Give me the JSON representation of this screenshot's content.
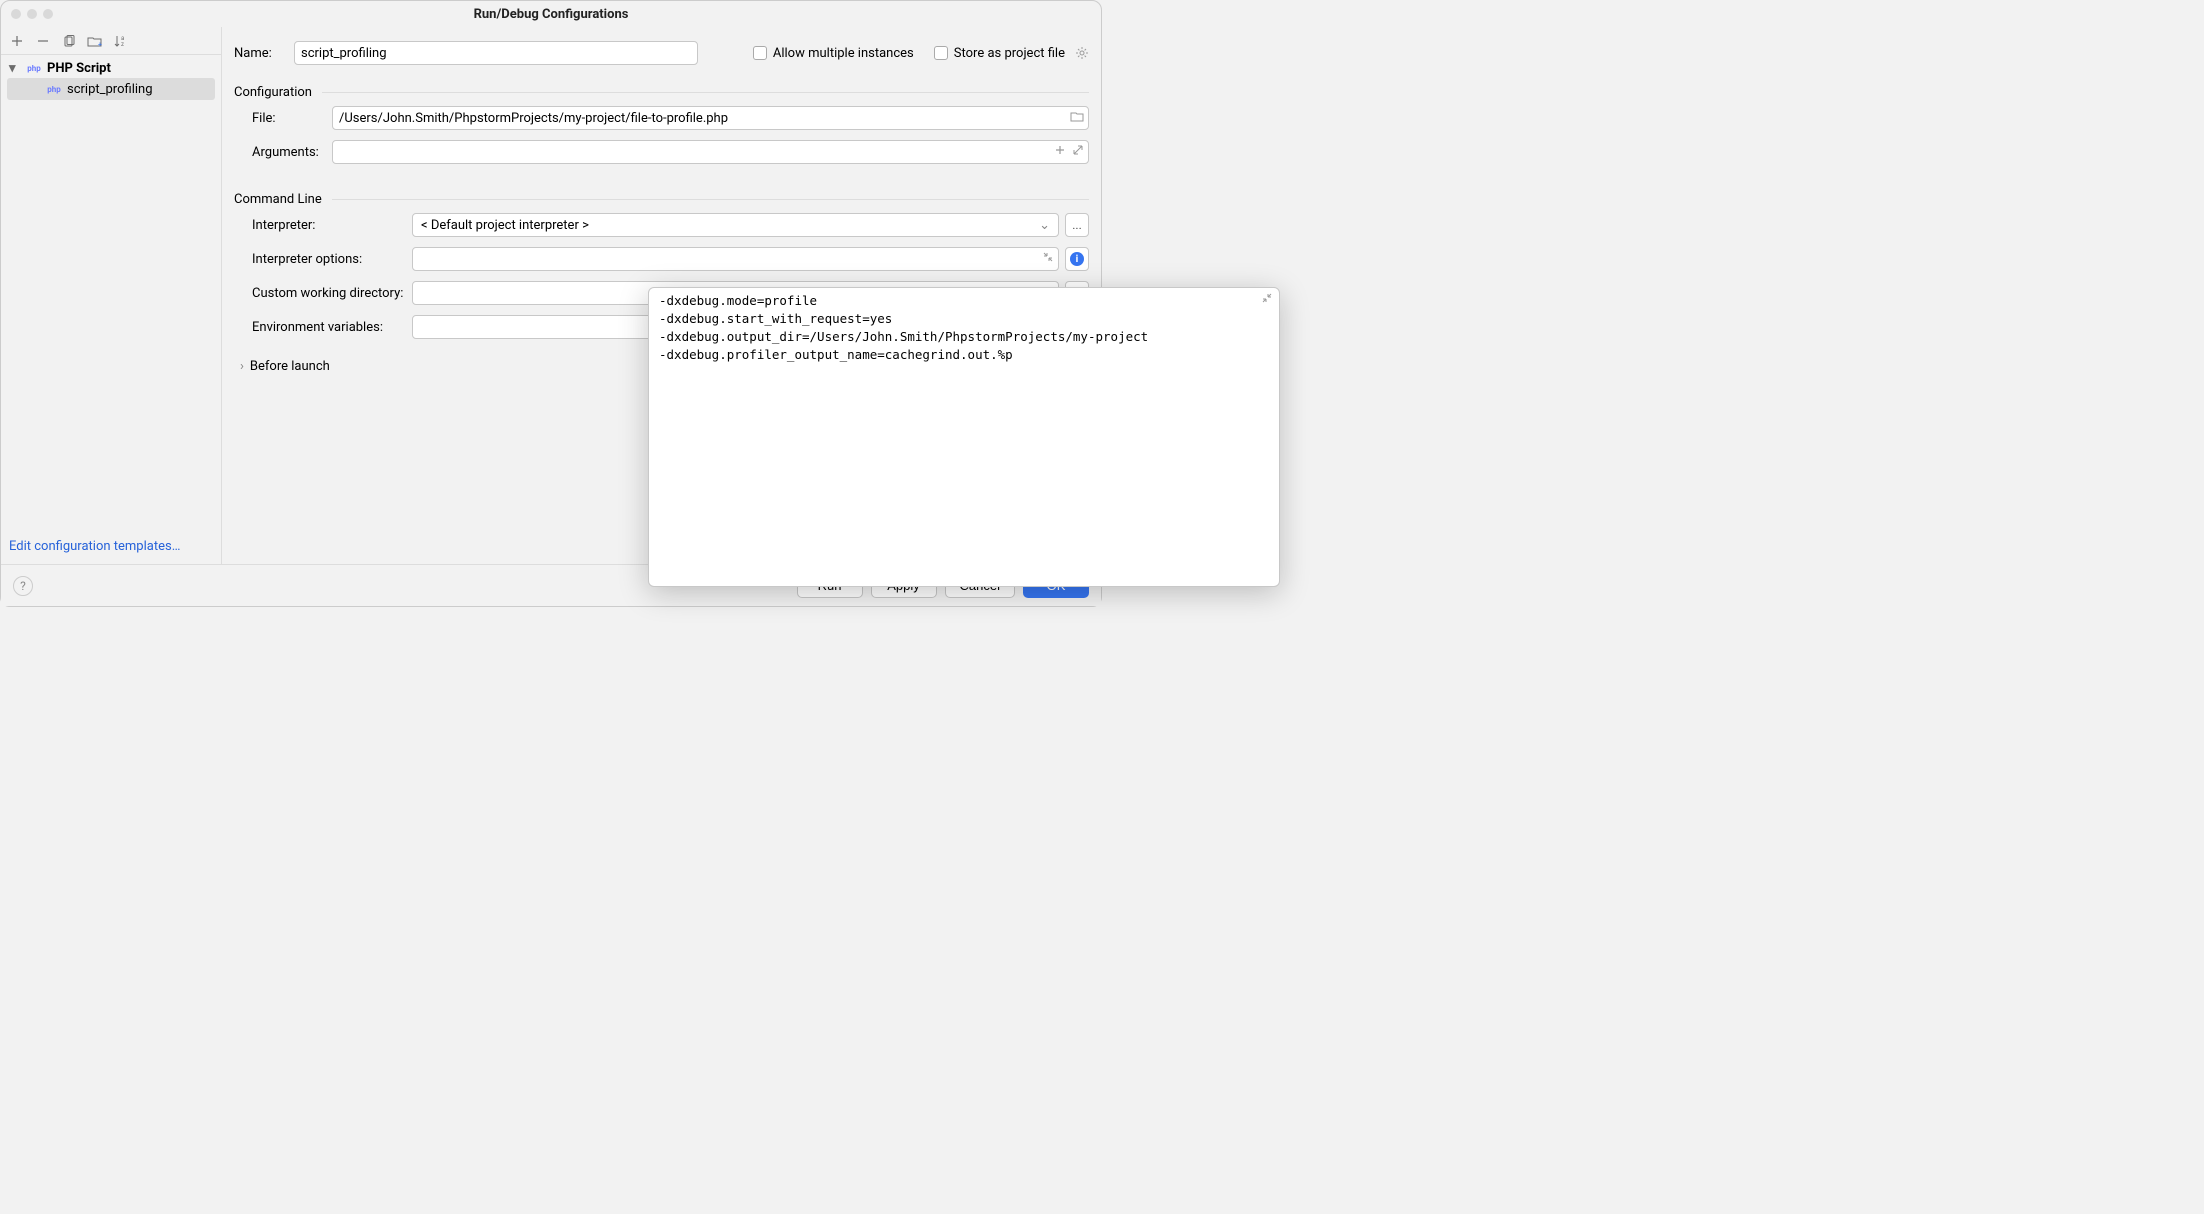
{
  "window": {
    "title": "Run/Debug Configurations"
  },
  "sidebar": {
    "root": {
      "label": "PHP Script"
    },
    "item": {
      "label": "script_profiling"
    },
    "editTemplates": "Edit configuration templates…"
  },
  "form": {
    "nameLabel": "Name:",
    "nameValue": "script_profiling",
    "allowMultiple": "Allow multiple instances",
    "storeProject": "Store as project file"
  },
  "sections": {
    "configuration": "Configuration",
    "commandLine": "Command Line",
    "beforeLaunch": "Before launch"
  },
  "config": {
    "fileLabel": "File:",
    "fileValue": "/Users/John.Smith/PhpstormProjects/my-project/file-to-profile.php",
    "argsLabel": "Arguments:",
    "argsValue": ""
  },
  "cmd": {
    "interpreterLabel": "Interpreter:",
    "interpreterValue": "< Default project interpreter >",
    "interpreterOptionsLabel": "Interpreter options:",
    "interpreterOptionsValue": "-dxdebug.mode=profile\n-dxdebug.start_with_request=yes\n-dxdebug.output_dir=/Users/John.Smith/PhpstormProjects/my-project\n-dxdebug.profiler_output_name=cachegrind.out.%p",
    "cwdLabel": "Custom working directory:",
    "cwdValue": "",
    "envLabel": "Environment variables:",
    "envValue": "",
    "browseBtn": "..."
  },
  "buttons": {
    "run": "Run",
    "apply": "Apply",
    "cancel": "Cancel",
    "ok": "OK"
  }
}
